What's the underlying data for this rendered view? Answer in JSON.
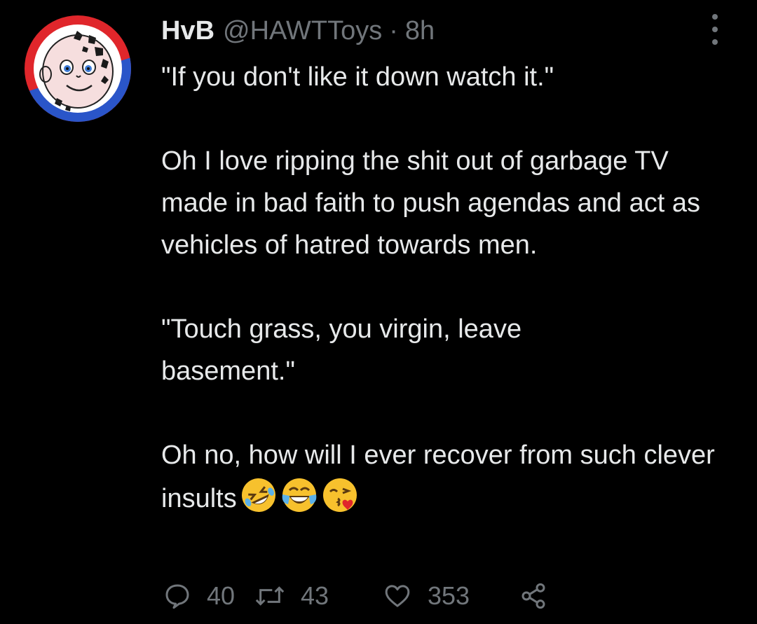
{
  "tweet": {
    "display_name": "HvB",
    "handle": "@HAWTToys",
    "separator": "·",
    "time": "8h",
    "paragraphs": [
      "\"If you don't like it down watch it.\"",
      "Oh I love ripping the shit out of garbage TV made in bad faith to push agendas and act as vehicles of hatred towards men.",
      "\"Touch grass, you virgin, leave basement.\"",
      "Oh no, how will I ever recover from such clever insults"
    ],
    "emojis": [
      "rolling-on-floor-laughing",
      "face-with-tears-of-joy",
      "face-blowing-kiss"
    ]
  },
  "actions": {
    "replies": "40",
    "retweets": "43",
    "likes": "353"
  },
  "icons": {
    "reply": "reply-icon",
    "retweet": "retweet-icon",
    "like": "heart-icon",
    "share": "share-icon",
    "more": "more-options-icon"
  },
  "colors": {
    "background": "#000000",
    "text": "#e7e9ea",
    "secondary": "#71767b",
    "avatar_red": "#e0262b",
    "avatar_blue": "#2a55c9"
  }
}
